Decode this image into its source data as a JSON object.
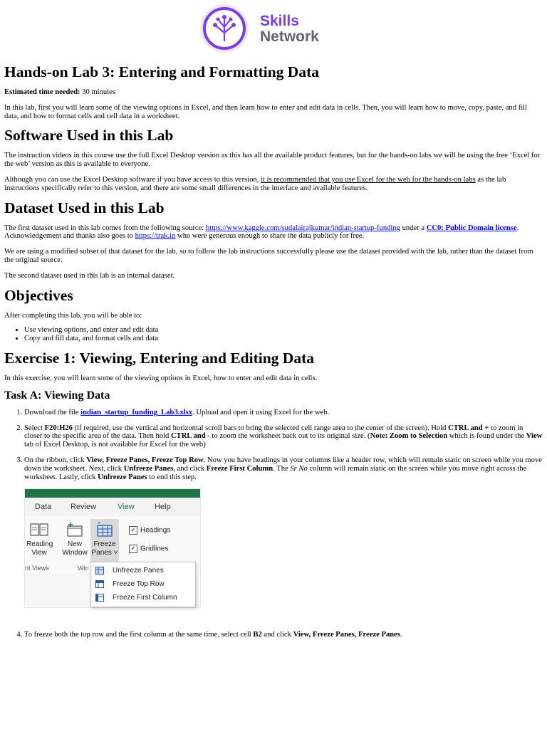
{
  "logo": {
    "line1": "Skills",
    "line2": "Network"
  },
  "title": "Hands-on Lab 3: Entering and Formatting Data",
  "time": {
    "label": "Estimated time needed:",
    "value": " 30 minutes"
  },
  "intro": "In this lab, first you will learn some of the viewing options in Excel, and then learn how to enter and edit data in cells. Then, you will learn how to move, copy, paste, and fill data, and how to format cells and cell data in a worksheet.",
  "software": {
    "heading": "Software Used in this Lab",
    "p1": "The instruction videos in this course use the full Excel Desktop version as this has all the available product features, but for the hands-on labs we will be using the free ‘Excel for the web’ version as this is available to everyone.",
    "p2_a": "Although you can use the Excel Desktop software if you have access to this version, ",
    "p2_u": "it is recommended that you use Excel for the web for the hands-on labs",
    "p2_b": " as the lab instructions specifically refer to this version, and there are some small differences in the interface and available features."
  },
  "dataset": {
    "heading": "Dataset Used in this Lab",
    "p1_a": "The first dataset used in this lab comes from the following source: ",
    "p1_link1": "https://www.kaggle.com/sudalairajkumar/indian-startup-funding",
    "p1_b": " under a ",
    "p1_link2": "CC0: Public Domain license",
    "p1_c": ". Acknowledgement and thanks also goes to ",
    "p1_link3": "https://trak.in",
    "p1_d": " who were generous enough to share the data publicly for free.",
    "p2": "We are using a modified subset of that dataset for the lab, so to follow the lab instructions successfully please use the dataset provided with the lab, rather than the dataset from the original source.",
    "p3": "The second dataset used in this lab is an internal dataset."
  },
  "objectives": {
    "heading": "Objectives",
    "intro": "After completing this lab, you will be able to:",
    "items": [
      "Use viewing options, and enter and edit data",
      "Copy and fill data, and format cells and data"
    ]
  },
  "exercise1": {
    "heading": "Exercise 1: Viewing, Entering and Editing Data",
    "intro": "In this exercise, you will learn some of the viewing options in Excel, how to enter and edit data in cells."
  },
  "taskA": {
    "heading": "Task A: Viewing Data",
    "s1_a": "Download the file ",
    "s1_link": "indian_startup_funding_Lab3.xlsx",
    "s1_b": ". Upload and open it using Excel for the web.",
    "s2_a": "Select ",
    "s2_b1": "F20:H26",
    "s2_c": " (if required, use the vertical and horizontal scroll bars to bring the selected cell range area to the center of the screen). Hold ",
    "s2_b2": "CTRL and +",
    "s2_d": " to zoom in closer to the specific area of the data. Then hold ",
    "s2_b3": "CTRL and -",
    "s2_e": " to zoom the worksheet back out to its original size. (",
    "s2_b4": "Note: Zoom to Selection",
    "s2_f": " which is found under the ",
    "s2_b5": "View",
    "s2_g": " tab of Excel Desktop, is not available for Excel for the web)",
    "s3_a": "On the ribbon, click ",
    "s3_b1": "View, Freeze Panes, Freeze Top Row",
    "s3_c": ". Now you have headings in your columns like a header row, which will remain static on screen while you move down the worksheet. Next, click ",
    "s3_b2": "Unfreeze Panes",
    "s3_d": ", and click ",
    "s3_b3": "Freeze First Column",
    "s3_e": ". The ",
    "s3_i": "Sr No",
    "s3_f": " column will remain static on the screen while you move right across the worksheet. Lastly, click ",
    "s3_b4": "Unfreeze Panes",
    "s3_g": " to end this step.",
    "s4_a": "To freeze both the top row and the first column at the same time, select cell ",
    "s4_b1": "B2",
    "s4_c": " and click ",
    "s4_b2": "View, Freeze Panes, Freeze Panes",
    "s4_d": "."
  },
  "excel": {
    "tabs": [
      "Data",
      "Review",
      "View",
      "Help"
    ],
    "reading_view": [
      "Reading",
      "View"
    ],
    "new_window": [
      "New",
      "Window"
    ],
    "freeze_panes": [
      "Freeze",
      "Panes ˅"
    ],
    "headings": "Headings",
    "gridlines": "Gridlines",
    "group_views": "nt Views",
    "group_window": "Win",
    "menu": [
      "Unfreeze Panes",
      "Freeze Top Row",
      "Freeze First Column"
    ],
    "green": "#217346"
  }
}
